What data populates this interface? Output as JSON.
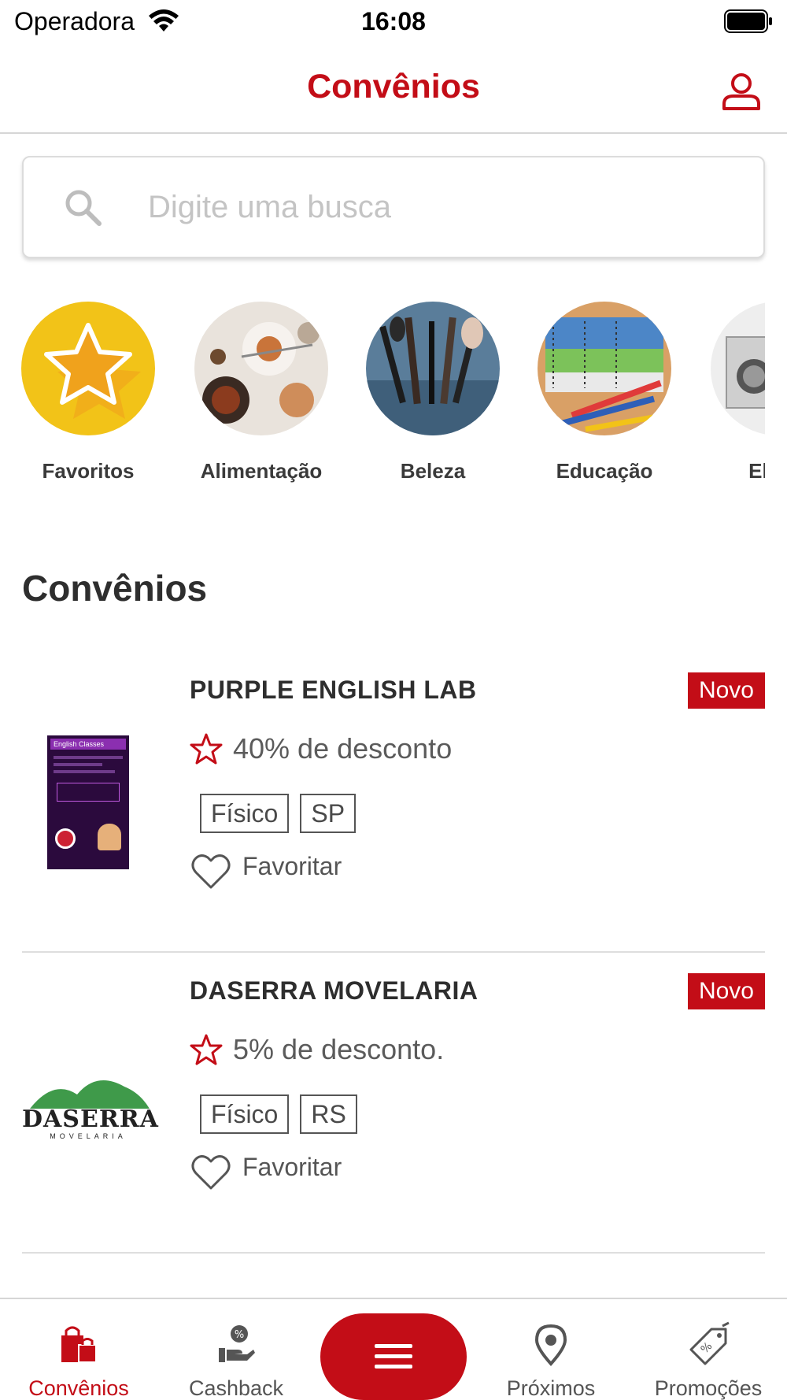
{
  "status_bar": {
    "carrier": "Operadora",
    "time": "16:08"
  },
  "header": {
    "title": "Convênios"
  },
  "search": {
    "placeholder": "Digite uma busca"
  },
  "categories": [
    {
      "label": "Favoritos",
      "icon": "star-icon"
    },
    {
      "label": "Alimentação",
      "icon": "food-photo"
    },
    {
      "label": "Beleza",
      "icon": "makeup-brushes-photo"
    },
    {
      "label": "Educação",
      "icon": "school-supplies-photo"
    },
    {
      "label": "Eletro",
      "icon": "appliances-photo"
    }
  ],
  "section_title": "Convênios",
  "deals": [
    {
      "name": "PURPLE ENGLISH LAB",
      "badge": "Novo",
      "discount": "40% de desconto",
      "tags": [
        "Físico",
        "SP"
      ],
      "favorite_label": "Favoritar",
      "logo_text": "English Classes"
    },
    {
      "name": "DASERRA MOVELARIA",
      "badge": "Novo",
      "discount": "5% de desconto.",
      "tags": [
        "Físico",
        "RS"
      ],
      "favorite_label": "Favoritar",
      "logo_text": "DASERRA",
      "logo_subtext": "MOVELARIA"
    }
  ],
  "tabbar": {
    "items": [
      {
        "label": "Convênios",
        "icon": "shopping-bags-icon",
        "active": true
      },
      {
        "label": "Cashback",
        "icon": "cashback-hand-icon",
        "active": false
      },
      {
        "label": "Próximos",
        "icon": "location-pin-icon",
        "active": false
      },
      {
        "label": "Promoções",
        "icon": "price-tag-icon",
        "active": false
      }
    ],
    "menu_icon": "hamburger-menu-icon"
  },
  "colors": {
    "brand": "#c30d17",
    "favorites_yellow": "#f2c318",
    "star_orange": "#f0a21c"
  }
}
